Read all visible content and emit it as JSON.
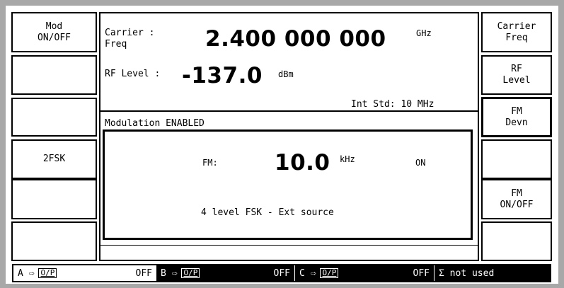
{
  "left_softkeys": [
    {
      "line1": "Mod",
      "line2": "ON/OFF"
    },
    {
      "line1": "",
      "line2": ""
    },
    {
      "line1": "",
      "line2": ""
    },
    {
      "line1": "2FSK",
      "line2": ""
    },
    {
      "line1": "",
      "line2": ""
    },
    {
      "line1": "",
      "line2": ""
    }
  ],
  "right_softkeys": [
    {
      "line1": "Carrier",
      "line2": "Freq"
    },
    {
      "line1": "RF",
      "line2": "Level"
    },
    {
      "line1": "FM",
      "line2": "Devn"
    },
    {
      "line1": "",
      "line2": ""
    },
    {
      "line1": "FM",
      "line2": "ON/OFF"
    },
    {
      "line1": "",
      "line2": ""
    }
  ],
  "carrier": {
    "label_line1": "Carrier  :",
    "label_line2": "Freq",
    "value": "2.400 000 000",
    "unit": "GHz"
  },
  "rf_level": {
    "label": "RF Level :",
    "value": "-137.0",
    "unit": "dBm"
  },
  "int_std": "Int Std: 10 MHz",
  "modulation_status": "Modulation ENABLED",
  "fm": {
    "label": "FM:",
    "value": "10.0",
    "unit": "kHz",
    "state": "ON"
  },
  "source_note": "4 level FSK - Ext source",
  "status_bar": {
    "a": {
      "label": "A ⇨",
      "op": "O/P",
      "state": "OFF"
    },
    "b": {
      "label": "B ⇨",
      "op": "O/P",
      "state": "OFF"
    },
    "c": {
      "label": "C ⇨",
      "op": "O/P",
      "state": "OFF"
    },
    "sigma": "Σ not used"
  }
}
